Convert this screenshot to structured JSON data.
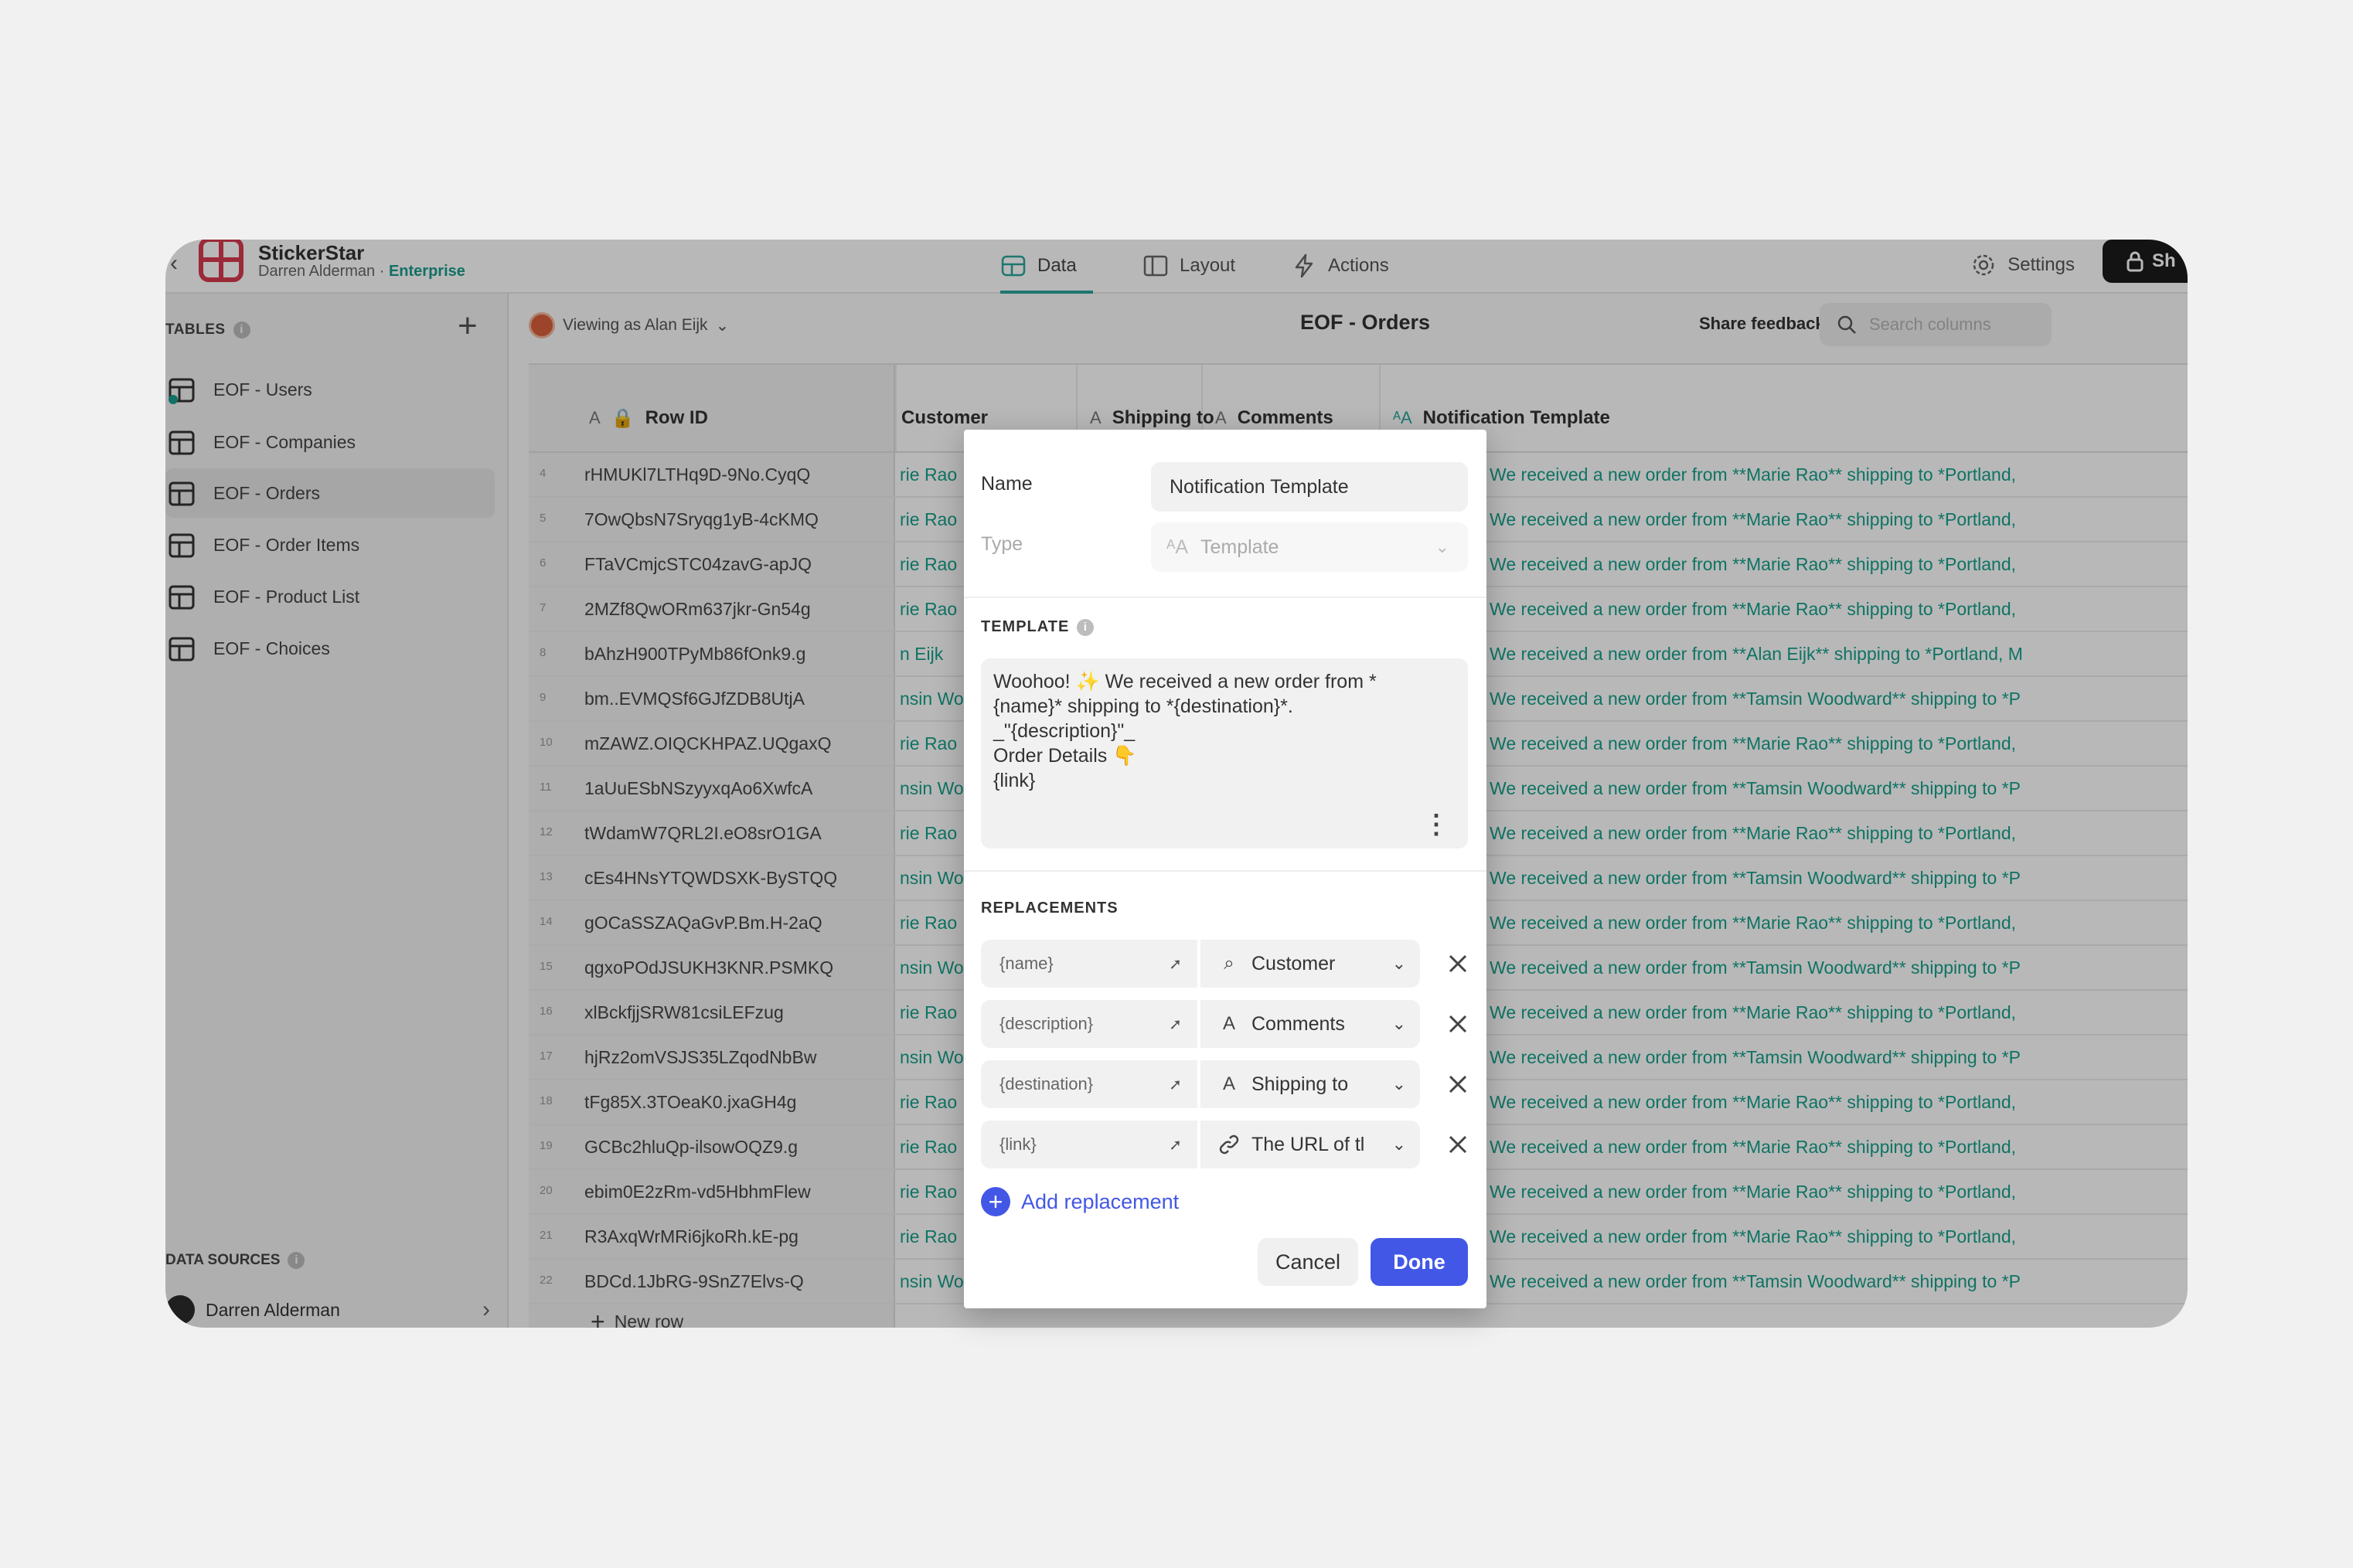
{
  "header": {
    "app_name": "StickerStar",
    "owner": "Darren Alderman",
    "separator": " · ",
    "plan": "Enterprise",
    "tabs": [
      {
        "label": "Data",
        "icon": "table-icon"
      },
      {
        "label": "Layout",
        "icon": "layout-icon"
      },
      {
        "label": "Actions",
        "icon": "lightning-icon"
      }
    ],
    "settings_label": "Settings",
    "share_label": "Sh"
  },
  "sidebar": {
    "tables_heading": "TABLES",
    "tables": [
      {
        "label": "EOF - Users"
      },
      {
        "label": "EOF - Companies"
      },
      {
        "label": "EOF - Orders",
        "active": true
      },
      {
        "label": "EOF - Order Items"
      },
      {
        "label": "EOF - Product List"
      },
      {
        "label": "EOF - Choices"
      }
    ],
    "data_sources_heading": "DATA SOURCES",
    "data_source_user": "Darren Alderman"
  },
  "main": {
    "viewing_as": "Viewing as Alan Eijk",
    "title": "EOF - Orders",
    "share_feedback": "Share feedback",
    "search_placeholder": "Search columns",
    "columns": {
      "row_id": "Row ID",
      "customer": "Customer",
      "shipping_to": "Shipping to",
      "comments": "Comments",
      "notification_template": "Notification Template",
      "type_tag": "A"
    },
    "rows": [
      {
        "num": "4",
        "id": "rHMUKl7LTHq9D-9No.CyqQ",
        "customer": "rie Rao",
        "note": "Woohoo! ✨ We received a new order from **Marie Rao** shipping to *Portland,"
      },
      {
        "num": "5",
        "id": "7OwQbsN7Sryqg1yB-4cKMQ",
        "customer": "rie Rao",
        "note": "Woohoo! ✨ We received a new order from **Marie Rao** shipping to *Portland,"
      },
      {
        "num": "6",
        "id": "FTaVCmjcSTC04zavG-apJQ",
        "customer": "rie Rao",
        "note": "Woohoo! ✨ We received a new order from **Marie Rao** shipping to *Portland,"
      },
      {
        "num": "7",
        "id": "2MZf8QwORm637jkr-Gn54g",
        "customer": "rie Rao",
        "note": "Woohoo! ✨ We received a new order from **Marie Rao** shipping to *Portland,"
      },
      {
        "num": "8",
        "id": "bAhzH900TPyMb86fOnk9.g",
        "customer": "n Eijk",
        "note": "Woohoo! ✨ We received a new order from **Alan Eijk** shipping to *Portland, M"
      },
      {
        "num": "9",
        "id": "bm..EVMQSf6GJfZDB8UtjA",
        "customer": "nsin Woo",
        "note": "Woohoo! ✨ We received a new order from **Tamsin Woodward** shipping to *P"
      },
      {
        "num": "10",
        "id": "mZAWZ.OIQCKHPAZ.UQgaxQ",
        "customer": "rie Rao",
        "note": "Woohoo! ✨ We received a new order from **Marie Rao** shipping to *Portland,"
      },
      {
        "num": "11",
        "id": "1aUuESbNSzyyxqAo6XwfcA",
        "customer": "nsin Woo",
        "note": "Woohoo! ✨ We received a new order from **Tamsin Woodward** shipping to *P"
      },
      {
        "num": "12",
        "id": "tWdamW7QRL2I.eO8srO1GA",
        "customer": "rie Rao",
        "note": "Woohoo! ✨ We received a new order from **Marie Rao** shipping to *Portland,"
      },
      {
        "num": "13",
        "id": "cEs4HNsYTQWDSXK-BySTQQ",
        "customer": "nsin Woo",
        "note": "Woohoo! ✨ We received a new order from **Tamsin Woodward** shipping to *P"
      },
      {
        "num": "14",
        "id": "gOCaSSZAQaGvP.Bm.H-2aQ",
        "customer": "rie Rao",
        "note": "Woohoo! ✨ We received a new order from **Marie Rao** shipping to *Portland,"
      },
      {
        "num": "15",
        "id": "qgxoPOdJSUKH3KNR.PSMKQ",
        "customer": "nsin Woo",
        "note": "Woohoo! ✨ We received a new order from **Tamsin Woodward** shipping to *P"
      },
      {
        "num": "16",
        "id": "xlBckfjjSRW81csiLEFzug",
        "customer": "rie Rao",
        "note": "Woohoo! ✨ We received a new order from **Marie Rao** shipping to *Portland,"
      },
      {
        "num": "17",
        "id": "hjRz2omVSJS35LZqodNbBw",
        "customer": "nsin Woo",
        "note": "Woohoo! ✨ We received a new order from **Tamsin Woodward** shipping to *P"
      },
      {
        "num": "18",
        "id": "tFg85X.3TOeaK0.jxaGH4g",
        "customer": "rie Rao",
        "note": "Woohoo! ✨ We received a new order from **Marie Rao** shipping to *Portland,"
      },
      {
        "num": "19",
        "id": "GCBc2hluQp-ilsowOQZ9.g",
        "customer": "rie Rao",
        "note": "Woohoo! ✨ We received a new order from **Marie Rao** shipping to *Portland,"
      },
      {
        "num": "20",
        "id": "ebim0E2zRm-vd5HbhmFlew",
        "customer": "rie Rao",
        "note": "Woohoo! ✨ We received a new order from **Marie Rao** shipping to *Portland,"
      },
      {
        "num": "21",
        "id": "R3AxqWrMRi6jkoRh.kE-pg",
        "customer": "rie Rao",
        "note": "Woohoo! ✨ We received a new order from **Marie Rao** shipping to *Portland,"
      },
      {
        "num": "22",
        "id": "BDCd.1JbRG-9SnZ7Elvs-Q",
        "customer": "nsin Woo",
        "note": "Woohoo! ✨ We received a new order from **Tamsin Woodward** shipping to *P"
      }
    ],
    "new_row_label": "New row"
  },
  "modal": {
    "name_label": "Name",
    "name_value": "Notification Template",
    "type_label": "Type",
    "type_value": "Template",
    "template_heading": "TEMPLATE",
    "template_lines": [
      "Woohoo! ✨ We received a new order from *",
      "{name}* shipping to *{destination}*.",
      "",
      "_\"{description}\"_",
      "",
      "Order Details 👇",
      "{link}"
    ],
    "replacements_heading": "REPLACEMENTS",
    "replacements": [
      {
        "key": "{name}",
        "value": "Customer",
        "icon": "lookup-icon"
      },
      {
        "key": "{description}",
        "value": "Comments",
        "icon": "text-icon"
      },
      {
        "key": "{destination}",
        "value": "Shipping to",
        "icon": "text-icon"
      },
      {
        "key": "{link}",
        "value": "The URL of tl",
        "icon": "link-icon"
      }
    ],
    "add_replacement": "Add replacement",
    "cancel": "Cancel",
    "done": "Done"
  },
  "colors": {
    "accent": "#4357e6",
    "link_teal": "#16a08b",
    "brand_red": "#d9394e"
  }
}
